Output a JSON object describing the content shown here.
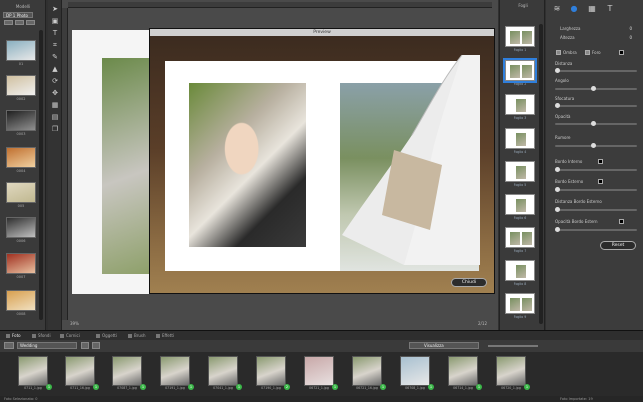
{
  "left_panel": {
    "title": "Modelli",
    "selector": "DP 1 Photo",
    "models": [
      {
        "label": "01"
      },
      {
        "label": "0002"
      },
      {
        "label": "0003"
      },
      {
        "label": "0004"
      },
      {
        "label": "005"
      },
      {
        "label": "0006"
      },
      {
        "label": "0007"
      },
      {
        "label": "0008"
      }
    ]
  },
  "tools": [
    "cursor-icon",
    "select-icon",
    "text-icon",
    "crop-icon",
    "pen-icon",
    "stamp-icon",
    "rotate-icon",
    "zoom-icon",
    "grid-icon",
    "layout-icon",
    "copy-icon"
  ],
  "canvas": {
    "zoom": "39%",
    "pages": "2/12"
  },
  "preview": {
    "title": "Preview",
    "close_label": "Chiudi"
  },
  "pages_panel": {
    "title": "Fogli",
    "items": [
      {
        "label": "Foglio 1"
      },
      {
        "label": "Foglio 2"
      },
      {
        "label": "Foglio 3"
      },
      {
        "label": "Foglio 4"
      },
      {
        "label": "Foglio 5"
      },
      {
        "label": "Foglio 6"
      },
      {
        "label": "Foglio 7"
      },
      {
        "label": "Foglio 8"
      },
      {
        "label": "Foglio 9"
      }
    ]
  },
  "properties": {
    "width_label": "Larghezza",
    "width_value": "0",
    "height_label": "Altezza",
    "height_value": "0",
    "shadow_label": "Ombra",
    "border_label": "Foro",
    "distance_label": "Distanza",
    "angle_label": "Angolo",
    "blur_label": "Sfocatura",
    "opacity_label": "Opacità",
    "noise_label": "Rumore",
    "inner_border_label": "Bordo Interno",
    "outer_border_label": "Bordo Esterno",
    "outer_distance_label": "Distanza Bordo Esterno",
    "outer_opacity_label": "Opacità Bordo Estern",
    "reset_label": "Reset"
  },
  "bottom_tabs": [
    {
      "label": "Foto",
      "active": true
    },
    {
      "label": "Sfondi",
      "active": false
    },
    {
      "label": "Cornici",
      "active": false
    },
    {
      "label": "Oggetti",
      "active": false
    },
    {
      "label": "Brush",
      "active": false
    },
    {
      "label": "Effetti",
      "active": false
    }
  ],
  "browser": {
    "folder": "Wedding",
    "view_label": "Visualizza"
  },
  "photos": [
    {
      "name": "0711_1.jpg",
      "count": "1"
    },
    {
      "name": "0711_16.jpg",
      "count": "1"
    },
    {
      "name": "07087_1.jpg",
      "count": "1"
    },
    {
      "name": "07191_1.jpg",
      "count": "1"
    },
    {
      "name": "07041_1.jpg",
      "count": "1"
    },
    {
      "name": "07190_1.jpg",
      "count": "2"
    },
    {
      "name": "06721_1.jpg",
      "count": "1"
    },
    {
      "name": "06721_16.jpg",
      "count": "1"
    },
    {
      "name": "06708_1.jpg",
      "count": "1"
    },
    {
      "name": "06714_1.jpg",
      "count": "1"
    },
    {
      "name": "06720_1.jpg",
      "count": "1"
    }
  ],
  "status": {
    "left": "Foto Selezionata: 0",
    "right": "Foto Importate: 19"
  },
  "colors": {
    "accent": "#2f7fdc",
    "badge": "#3cb84a"
  }
}
